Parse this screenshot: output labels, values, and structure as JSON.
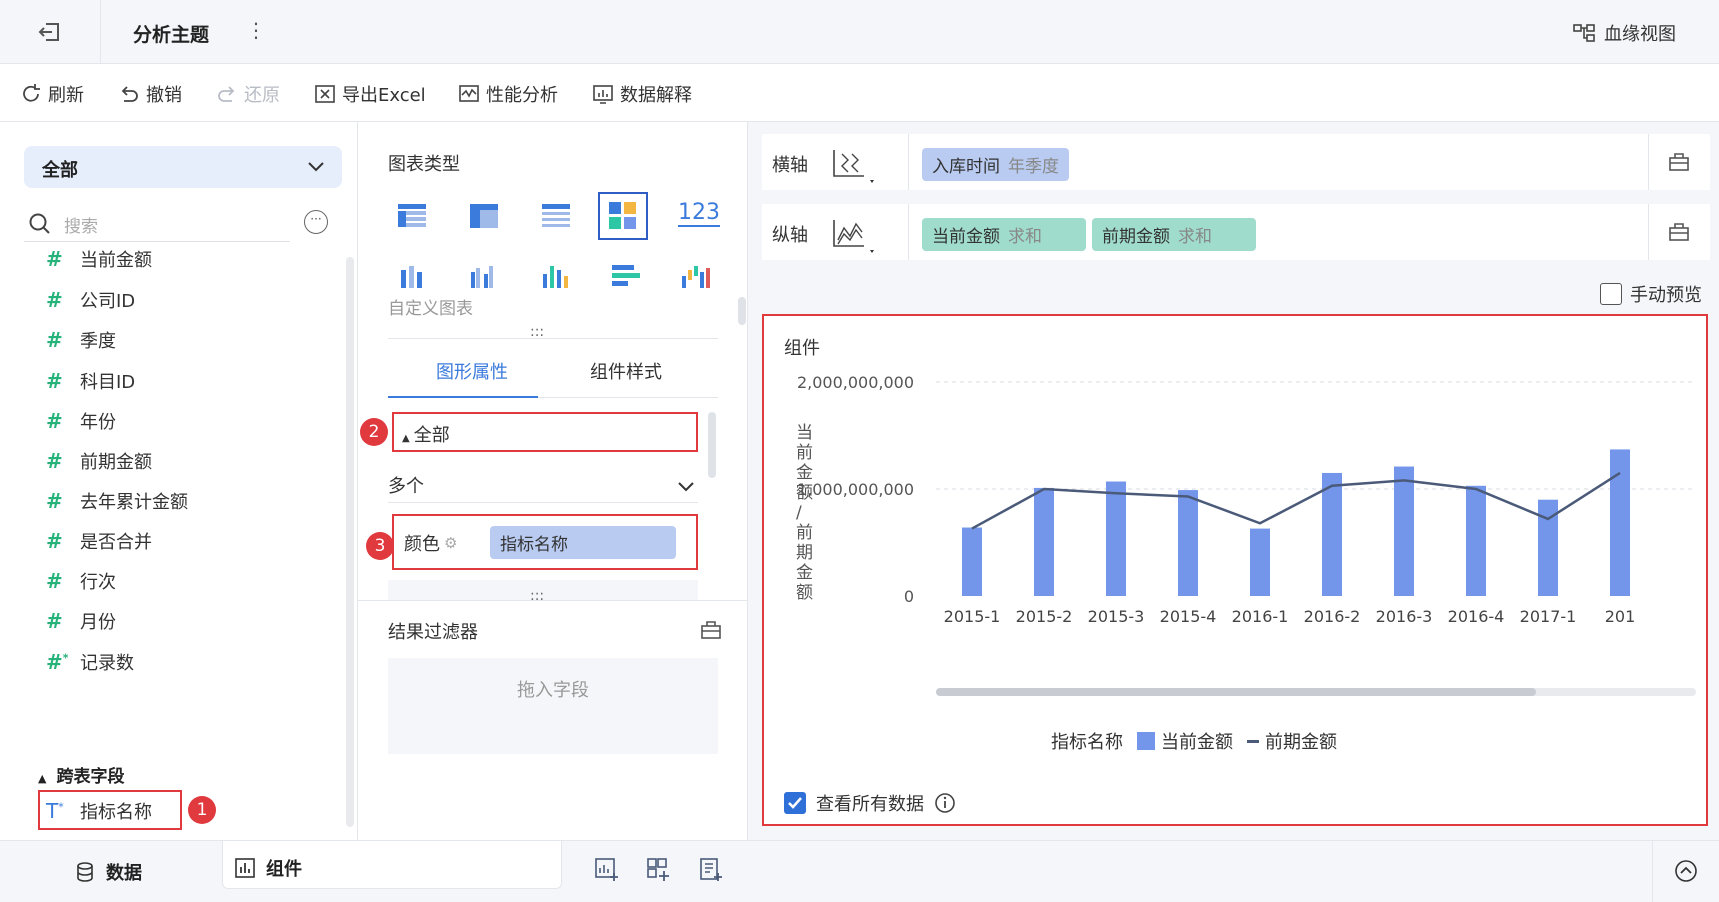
{
  "topbar": {
    "title": "分析主题",
    "more": "⋮",
    "lineage_label": "血缘视图"
  },
  "toolbar": {
    "refresh": "刷新",
    "undo": "撤销",
    "redo": "还原",
    "export": "导出Excel",
    "perf": "性能分析",
    "explain": "数据解释"
  },
  "left": {
    "dropdown": "全部",
    "search_placeholder": "搜索",
    "fields": [
      "当前金额",
      "公司ID",
      "季度",
      "科目ID",
      "年份",
      "前期金额",
      "去年累计金额",
      "是否合并",
      "行次",
      "月份",
      "记录数"
    ],
    "cross_section": "跨表字段",
    "cross_field": "指标名称",
    "badge1": "1"
  },
  "mid": {
    "chart_type_label": "图表类型",
    "custom_chart": "自定义图表",
    "tab_shape": "图形属性",
    "tab_style": "组件样式",
    "all_label": "全部",
    "badge2": "2",
    "multi_label": "多个",
    "color_label": "颜色",
    "color_field": "指标名称",
    "badge3": "3",
    "result_filter": "结果过滤器",
    "drop_field": "拖入字段",
    "num_icon": "123"
  },
  "right": {
    "x_axis_label": "横轴",
    "x_field": "入库时间",
    "x_field_sub": "年季度",
    "y_axis_label": "纵轴",
    "y_field1": "当前金额",
    "y_field1_sub": "求和",
    "y_field2": "前期金额",
    "y_field2_sub": "求和",
    "manual_preview": "手动预览",
    "component_title": "组件",
    "view_all": "查看所有数据"
  },
  "chart_data": {
    "type": "bar",
    "categories": [
      "2015-1",
      "2015-2",
      "2015-3",
      "2015-4",
      "2016-1",
      "2016-2",
      "2016-3",
      "2016-4",
      "2017-1",
      "201"
    ],
    "series": [
      {
        "name": "当前金额",
        "type": "bar",
        "values": [
          640000000,
          1010000000,
          1070000000,
          990000000,
          630000000,
          1150000000,
          1210000000,
          1030000000,
          900000000,
          1370000000
        ]
      },
      {
        "name": "前期金额",
        "type": "line",
        "values": [
          630000000,
          1000000000,
          960000000,
          930000000,
          680000000,
          1030000000,
          1080000000,
          1000000000,
          720000000,
          1150000000
        ]
      }
    ],
    "ylabel": "当前金额/前期金额",
    "y_ticks": [
      "2,000,000,000",
      "1,000,000,000",
      "0"
    ],
    "ylim": [
      0,
      2000000000
    ],
    "legend_title": "指标名称",
    "legend": [
      "当前金额",
      "前期金额"
    ],
    "colors": {
      "bar": "#7396eb",
      "line": "#4a5a78"
    }
  }
}
